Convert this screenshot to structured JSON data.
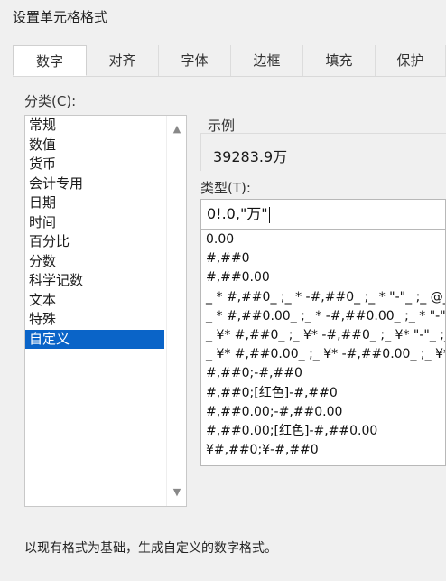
{
  "dialog": {
    "title": "设置单元格格式"
  },
  "tabs": [
    {
      "label": "数字",
      "active": true
    },
    {
      "label": "对齐"
    },
    {
      "label": "字体"
    },
    {
      "label": "边框"
    },
    {
      "label": "填充"
    },
    {
      "label": "保护"
    }
  ],
  "category": {
    "label": "分类(C):",
    "items": [
      "常规",
      "数值",
      "货币",
      "会计专用",
      "日期",
      "时间",
      "百分比",
      "分数",
      "科学记数",
      "文本",
      "特殊",
      "自定义"
    ],
    "selected": "自定义"
  },
  "sample": {
    "label": "示例",
    "value": "39283.9万"
  },
  "type": {
    "label": "类型(T):",
    "value": "0!.0,\"万\"",
    "formats": [
      "0.00",
      "#,##0",
      "#,##0.00",
      "_ * #,##0_ ;_ * -#,##0_ ;_ * \"-\"_ ;_ @_",
      "_ * #,##0.00_ ;_ * -#,##0.00_ ;_ * \"-\"?",
      "_ ¥* #,##0_ ;_ ¥* -#,##0_ ;_ ¥* \"-\"_ ;_",
      "_ ¥* #,##0.00_ ;_ ¥* -#,##0.00_ ;_ ¥*",
      "#,##0;-#,##0",
      "#,##0;[红色]-#,##0",
      "#,##0.00;-#,##0.00",
      "#,##0.00;[红色]-#,##0.00",
      "¥#,##0;¥-#,##0"
    ]
  },
  "hint": "以现有格式为基础，生成自定义的数字格式。",
  "colors": {
    "selection": "#0a64c8"
  }
}
